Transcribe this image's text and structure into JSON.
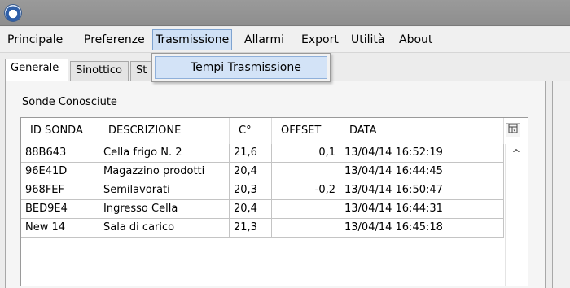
{
  "menubar": {
    "items": [
      "Principale",
      "Preferenze",
      "Trasmissione",
      "Allarmi",
      "Export",
      "Utilità",
      "About"
    ]
  },
  "dropdown": {
    "items": [
      "Tempi Trasmissione"
    ]
  },
  "tabs": {
    "items": [
      "Generale",
      "Sinottico",
      "St"
    ]
  },
  "panel": {
    "group_title": "Sonde Conosciute"
  },
  "table": {
    "columns": [
      "ID SONDA",
      "DESCRIZIONE",
      "C°",
      "OFFSET",
      "DATA"
    ],
    "rows": [
      {
        "id": "88B643",
        "descrizione": "Cella frigo N. 2",
        "c": "21,6",
        "offset": "0,1",
        "data": "13/04/14 16:52:19"
      },
      {
        "id": "96E41D",
        "descrizione": "Magazzino prodotti",
        "c": "20,4",
        "offset": "",
        "data": "13/04/14 16:44:45"
      },
      {
        "id": "968FEF",
        "descrizione": "Semilavorati",
        "c": "20,3",
        "offset": "-0,2",
        "data": "13/04/14 16:50:47"
      },
      {
        "id": "BED9E4",
        "descrizione": "Ingresso Cella",
        "c": "20,4",
        "offset": "",
        "data": "13/04/14 16:44:31"
      },
      {
        "id": "New 14",
        "descrizione": "Sala di carico",
        "c": "21,3",
        "offset": "",
        "data": "13/04/14 16:45:18"
      }
    ],
    "column_selector_icon": "column-chooser-icon",
    "scroll_up_glyph": "^"
  },
  "icons": {
    "app": "app-logo-icon"
  }
}
